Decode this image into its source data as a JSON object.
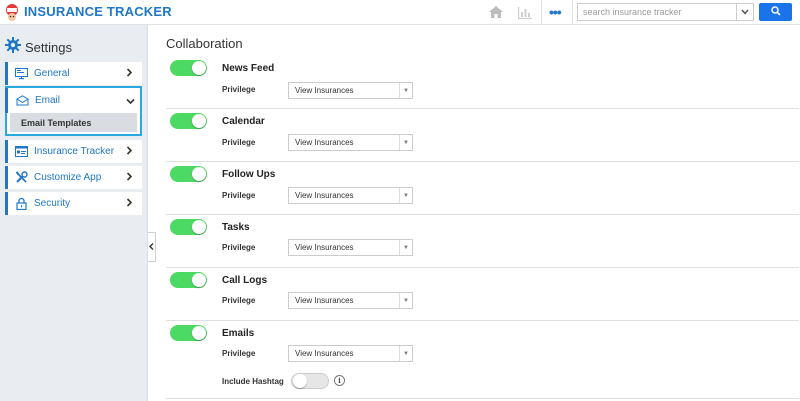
{
  "header": {
    "app_title": "INSURANCE TRACKER",
    "search_placeholder": "search insurance tracker",
    "icons": [
      "home-icon",
      "chart-icon",
      "more-icon",
      "search-dropdown-icon",
      "search-icon"
    ]
  },
  "sidebar": {
    "title": "Settings",
    "items": [
      {
        "label": "General",
        "icon": "monitor-icon"
      },
      {
        "label": "Email",
        "icon": "envelope-icon"
      },
      {
        "label": "Insurance Tracker",
        "icon": "card-icon"
      },
      {
        "label": "Customize App",
        "icon": "tools-icon"
      },
      {
        "label": "Security",
        "icon": "lock-icon"
      }
    ],
    "email_sub_item": "Email Templates"
  },
  "main": {
    "section_title": "Collaboration",
    "privilege_label": "Privilege",
    "rows": [
      {
        "title": "News Feed",
        "enabled": true,
        "privilege": "View Insurances"
      },
      {
        "title": "Calendar",
        "enabled": true,
        "privilege": "View Insurances"
      },
      {
        "title": "Follow Ups",
        "enabled": true,
        "privilege": "View Insurances"
      },
      {
        "title": "Tasks",
        "enabled": true,
        "privilege": "View Insurances"
      },
      {
        "title": "Call Logs",
        "enabled": true,
        "privilege": "View Insurances"
      },
      {
        "title": "Emails",
        "enabled": true,
        "privilege": "View Insurances"
      }
    ],
    "hashtag_label": "Include Hashtag",
    "hashtag_enabled": false
  },
  "colors": {
    "accent": "#1f77c9",
    "toggle_on": "#4cd964",
    "highlight": "#29a9e0"
  }
}
